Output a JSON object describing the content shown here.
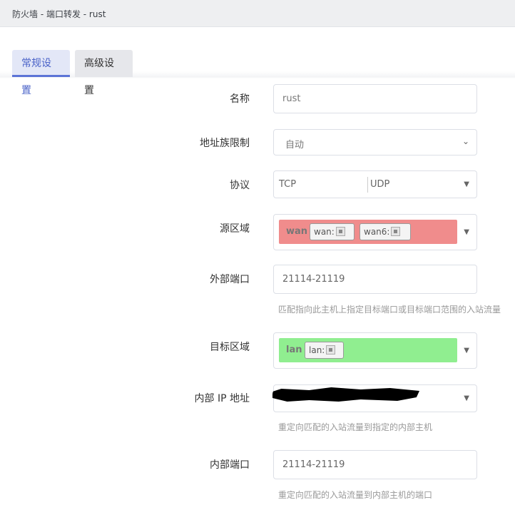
{
  "titlebar": {
    "title": "防火墙 - 端口转发 - rust"
  },
  "tabs": [
    {
      "label": "常规设置",
      "active": true
    },
    {
      "label": "高级设置",
      "active": false
    }
  ],
  "form": {
    "name": {
      "label": "名称",
      "value": "rust"
    },
    "family": {
      "label": "地址族限制",
      "value": "自动"
    },
    "protocol": {
      "label": "协议",
      "options": [
        "TCP",
        "UDP"
      ]
    },
    "src_zone": {
      "label": "源区域",
      "zone": "wan",
      "color": "#f08c8c",
      "interfaces": [
        "wan:",
        "wan6:"
      ]
    },
    "ext_port": {
      "label": "外部端口",
      "value": "21114-21119",
      "hint": "匹配指向此主机上指定目标端口或目标端口范围的入站流量"
    },
    "dest_zone": {
      "label": "目标区域",
      "zone": "lan",
      "color": "#90ee90",
      "interfaces": [
        "lan:"
      ]
    },
    "internal_ip": {
      "label": "内部 IP 地址",
      "hint": "重定向匹配的入站流量到指定的内部主机"
    },
    "internal_port": {
      "label": "内部端口",
      "value": "21114-21119",
      "hint": "重定向匹配的入站流量到内部主机的端口"
    }
  }
}
